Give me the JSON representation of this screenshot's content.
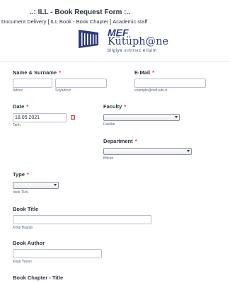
{
  "header": {
    "title": "..: ILL - Book Request Form :..",
    "subtitle": "Document Delivery [ ILL Book - Book Chapter ] Academic staff"
  },
  "logo": {
    "mef": "MEF",
    "name": "Kütüph@ne",
    "tagline": "bilgiye sınırsız erişim"
  },
  "fields": {
    "name": {
      "label": "Name & Surname",
      "required": "*",
      "first_sub": "Adınız",
      "last_sub": "Soyadınız",
      "first_value": "",
      "last_value": ""
    },
    "email": {
      "label": "E-Mail",
      "required": "*",
      "sub": "example@mef.edu.tr",
      "value": ""
    },
    "date": {
      "label": "Date",
      "required": "*",
      "value": "18.05.2021",
      "sub": "Tarih"
    },
    "faculty": {
      "label": "Faculty",
      "required": "*",
      "sub": "Fakülte",
      "value": ""
    },
    "department": {
      "label": "Department",
      "required": "*",
      "sub": "Bölüm",
      "value": ""
    },
    "type": {
      "label": "Type",
      "required": "*",
      "sub": "İstek Türü",
      "value": ""
    },
    "book_title": {
      "label": "Book Title",
      "sub": "Kitap Başlığı",
      "value": ""
    },
    "book_author": {
      "label": "Book Author",
      "sub": "Kitap Yazarı",
      "value": ""
    },
    "chapter_title": {
      "label": "Book Chapter - Title"
    }
  },
  "colors": {
    "brand": "#2e3b7b",
    "required": "#e4254d",
    "calendar": "#c0392b"
  },
  "icons": {
    "calendar": "calendar-icon",
    "dropdown": "chevron-down-icon",
    "logo": "mef-library-logo"
  }
}
